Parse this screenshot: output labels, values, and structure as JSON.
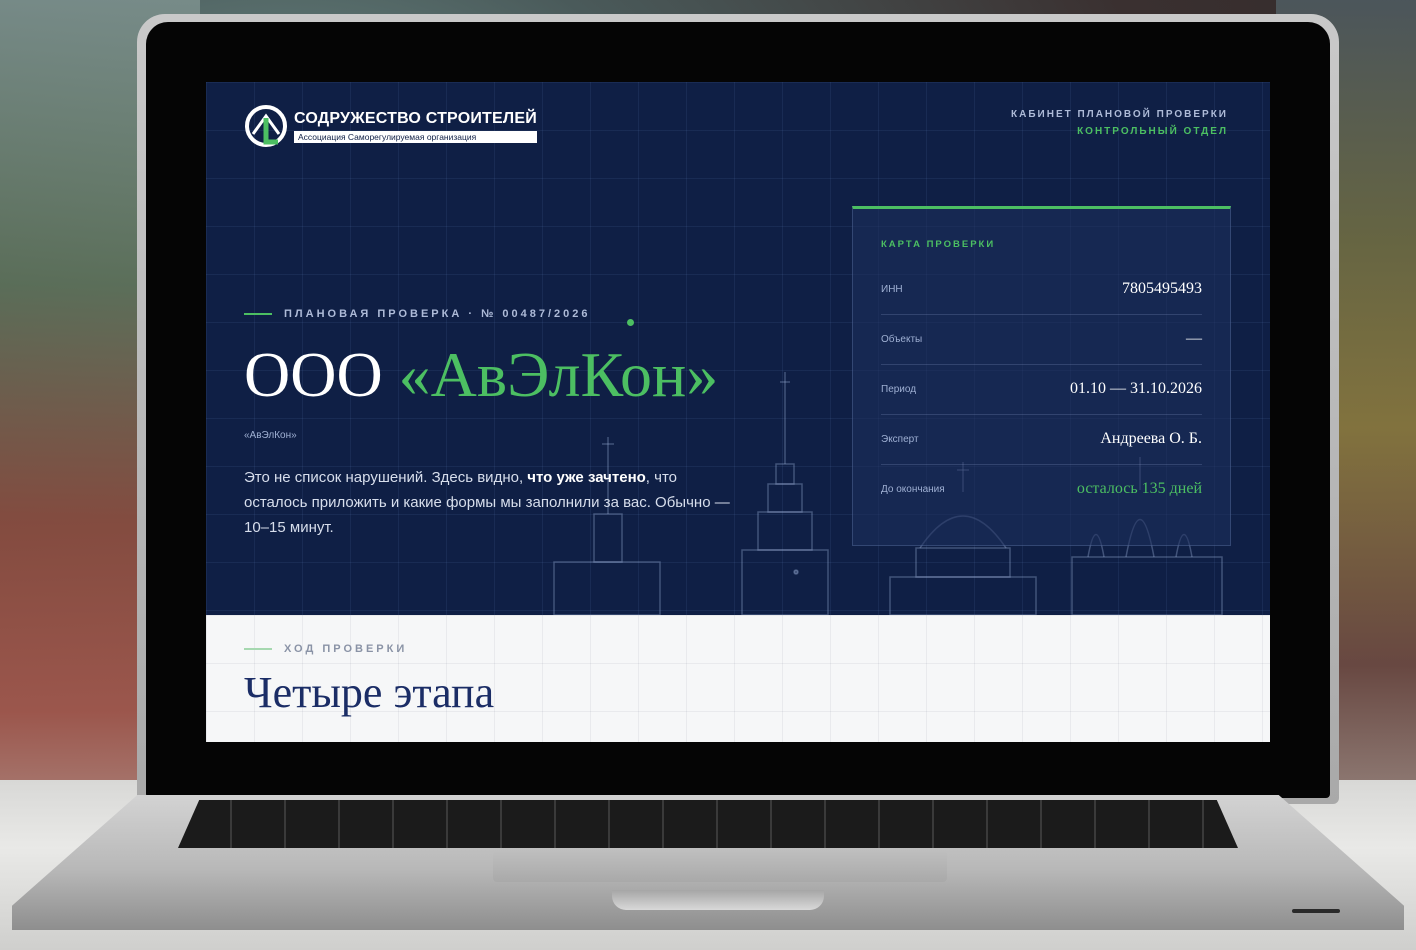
{
  "brand": {
    "name": "СОДРУЖЕСТВО СТРОИТЕЛЕЙ",
    "subtitle": "Ассоциация Саморегулируемая организация"
  },
  "header": {
    "cabinet": "КАБИНЕТ ПЛАНОВОЙ ПРОВЕРКИ",
    "department": "КОНТРОЛЬНЫЙ ОТДЕЛ"
  },
  "hero": {
    "eyebrow": "ПЛАНОВАЯ ПРОВЕРКА · № 00487/2026",
    "company_prefix": "ООО",
    "company_name": "«АвЭлКон»",
    "alias": "«АвЭлКон»",
    "lead_part1": "Это не список нарушений. Здесь видно, ",
    "lead_bold": "что уже зачтено",
    "lead_part2": ", что осталось приложить и какие формы мы заполнили за вас. Обычно — 10–15 минут."
  },
  "card": {
    "title": "КАРТА ПРОВЕРКИ",
    "rows": [
      {
        "label": "ИНН",
        "value": "7805495493"
      },
      {
        "label": "Объекты",
        "value": "—"
      },
      {
        "label": "Период",
        "value": "01.10 — 31.10.2026"
      },
      {
        "label": "Эксперт",
        "value": "Андреева О. Б."
      },
      {
        "label": "До окончания",
        "value": "осталось 135 дней"
      }
    ]
  },
  "section": {
    "eyebrow": "ХОД ПРОВЕРКИ",
    "title": "Четыре этапа"
  },
  "colors": {
    "navy": "#0f1f45",
    "accent_green": "#4cbf62",
    "title_blue": "#1b2d66"
  }
}
